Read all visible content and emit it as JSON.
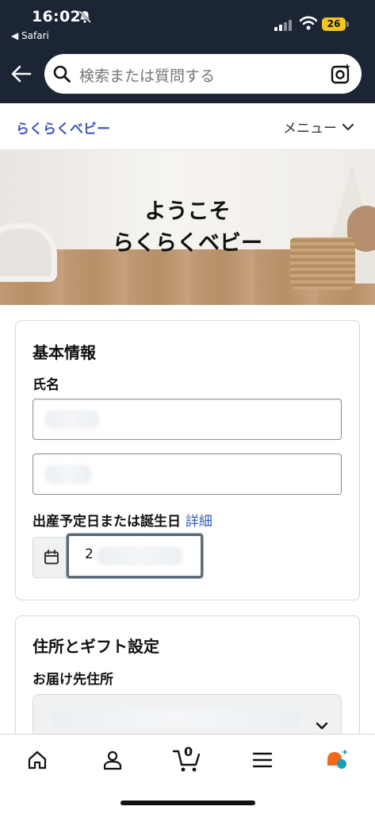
{
  "status_bar": {
    "time": "16:02",
    "back_app": "◀ Safari",
    "battery": "26"
  },
  "search": {
    "placeholder": "検索または質問する"
  },
  "site_nav": {
    "brand": "らくらくベビー",
    "menu_label": "メニュー"
  },
  "hero": {
    "line1": "ようこそ",
    "line2": "らくらくベビー"
  },
  "basic_info": {
    "title": "基本情報",
    "name_label": "氏名",
    "due_date_label": "出産予定日または誕生日",
    "detail_link": "詳細",
    "due_date_value": "2"
  },
  "address": {
    "title": "住所とギフト設定",
    "delivery_label": "お届け先住所"
  },
  "tabbar": {
    "cart_count": "0",
    "icons": [
      "home-icon",
      "account-icon",
      "cart-icon",
      "menu-icon",
      "assistant-icon"
    ]
  },
  "colors": {
    "header_bg": "#1b2533",
    "brand_link": "#3e59b8",
    "battery": "#f2c71a",
    "assistant_orange": "#f0691e",
    "assistant_teal": "#1a9fb2"
  }
}
